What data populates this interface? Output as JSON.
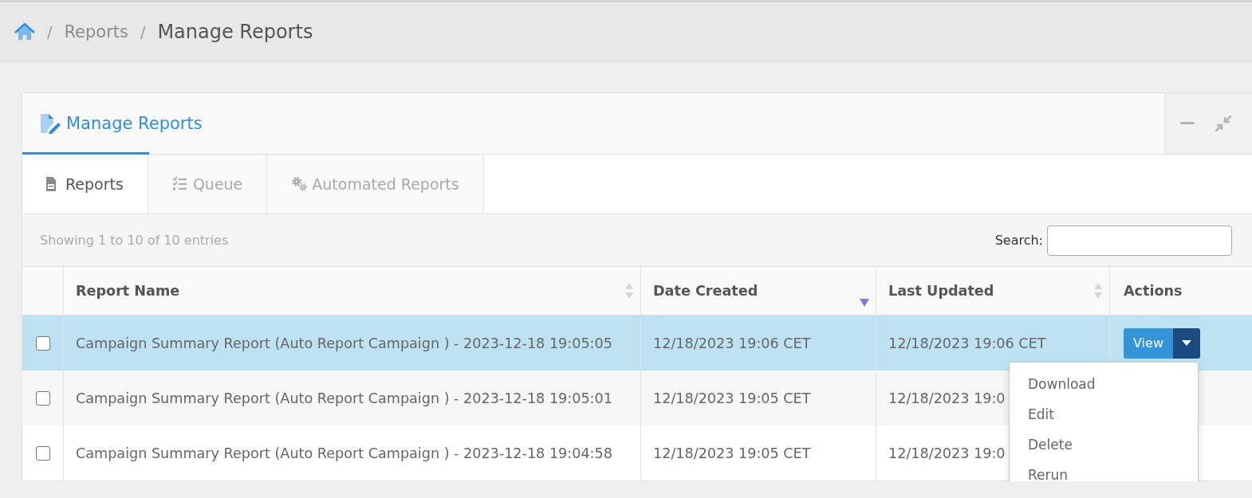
{
  "breadcrumb": [
    {
      "separator": "/",
      "label": "Reports",
      "current": false
    },
    {
      "separator": "/",
      "label": "Manage Reports",
      "current": true
    }
  ],
  "panel": {
    "title": "Manage Reports"
  },
  "tabs": [
    {
      "label": "Reports",
      "selected": true
    },
    {
      "label": "Queue",
      "selected": false
    },
    {
      "label": "Automated Reports",
      "selected": false
    }
  ],
  "info": "Showing 1 to 10 of 10 entries",
  "search": {
    "label": "Search:"
  },
  "table": {
    "columns": [
      {
        "label": "Report Name",
        "kind": "sortable"
      },
      {
        "label": "Date Created",
        "kind": "sorted-desc"
      },
      {
        "label": "Last Updated",
        "kind": "sortable"
      },
      {
        "label": "Actions",
        "kind": "plain"
      }
    ],
    "rows": [
      {
        "selected": true,
        "checked": false,
        "name": "Campaign Summary Report (Auto Report Campaign ) - 2023-12-18 19:05:05",
        "created": "12/18/2023 19:06 CET",
        "updated": "12/18/2023 19:06 CET",
        "action": "View",
        "menu": [
          "Download",
          "Edit",
          "Delete",
          "Rerun"
        ]
      },
      {
        "selected": false,
        "checked": false,
        "name": "Campaign Summary Report (Auto Report Campaign ) - 2023-12-18 19:05:01",
        "created": "12/18/2023 19:05 CET",
        "updated": "12/18/2023 19:0"
      },
      {
        "selected": false,
        "checked": false,
        "name": "Campaign Summary Report (Auto Report Campaign ) - 2023-12-18 19:04:58",
        "created": "12/18/2023 19:05 CET",
        "updated": "12/18/2023 19:0"
      }
    ]
  }
}
